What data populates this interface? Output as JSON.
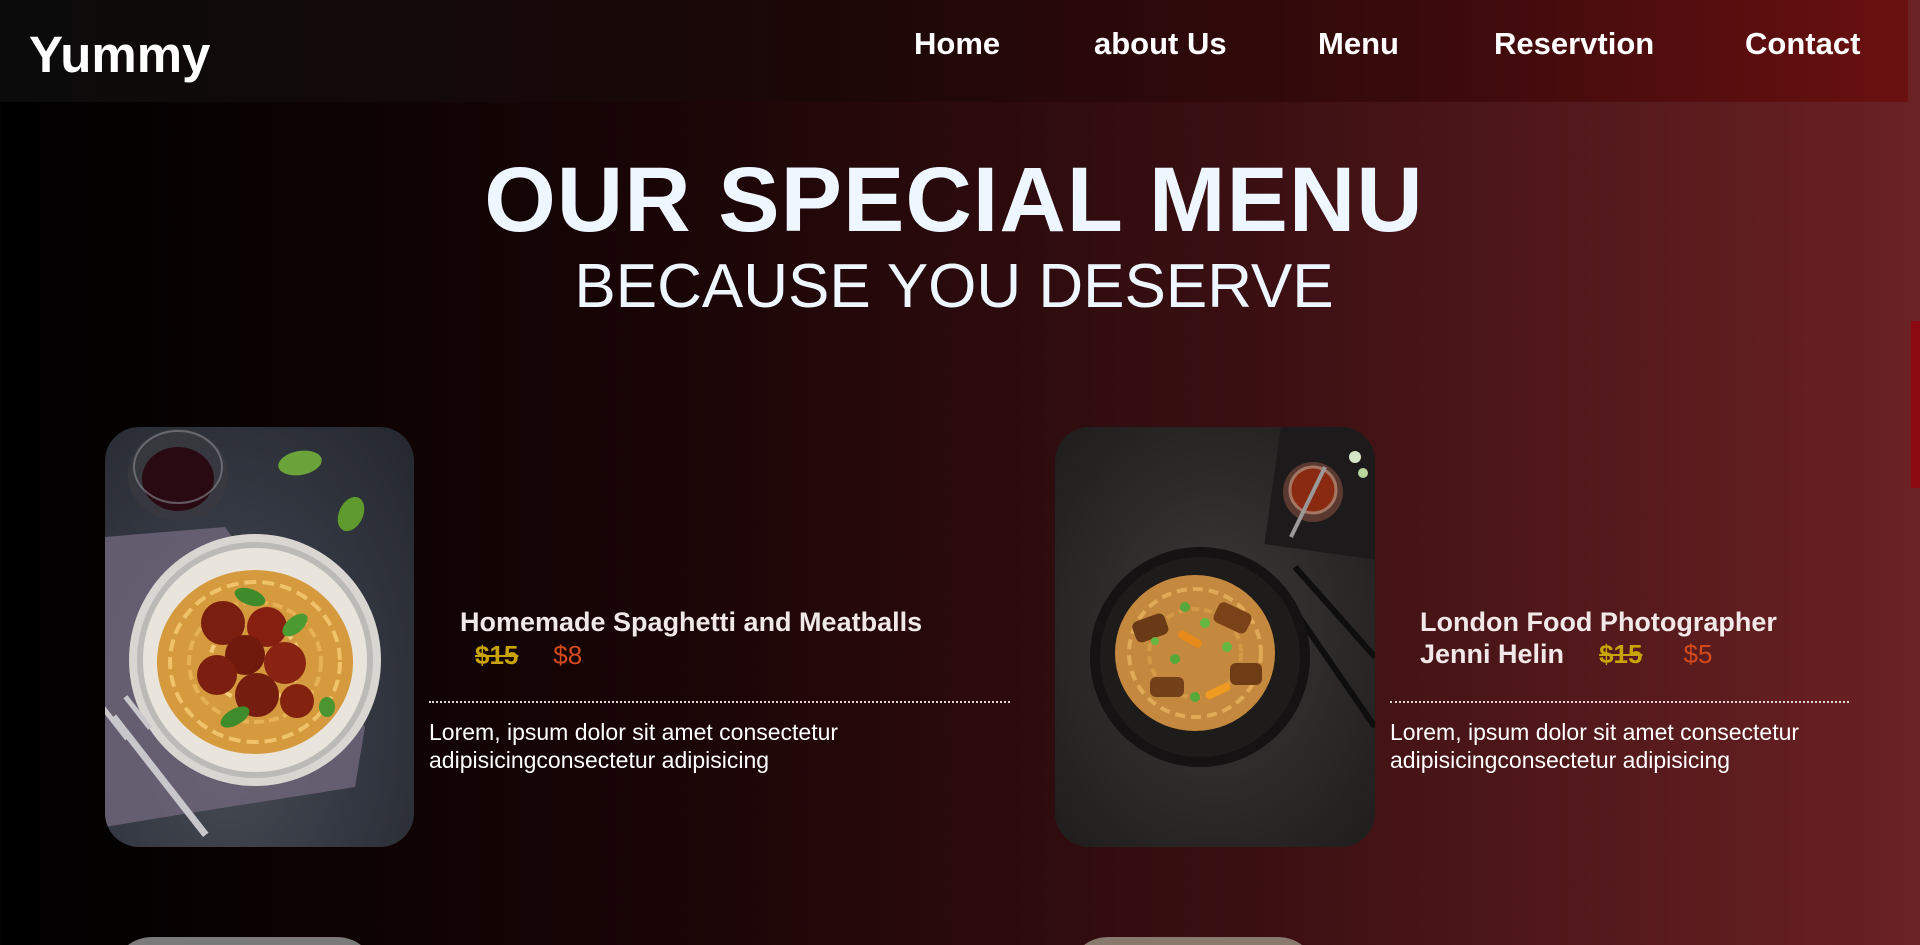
{
  "brand": "Yummy",
  "nav": {
    "home": "Home",
    "about": "about Us",
    "menu": "Menu",
    "reservation": "Reservtion",
    "contact": "Contact"
  },
  "hero": {
    "title": "OUR SPECIAL MENU",
    "subtitle": "BECAUSE YOU DESERVE"
  },
  "dishes": [
    {
      "name": "Homemade Spaghetti and Meatballs",
      "old_price": "$15",
      "new_price": "$8",
      "description_line1": "Lorem, ipsum dolor sit amet consectetur",
      "description_line2": "adipisicingconsectetur adipisicing"
    },
    {
      "name_line1": "London Food Photographer",
      "name_line2": "Jenni Helin",
      "old_price": "$15",
      "new_price": "$5",
      "description_line1": "Lorem, ipsum dolor sit amet consectetur",
      "description_line2": "adipisicingconsectetur adipisicing"
    }
  ],
  "colors": {
    "old_price": "#c9a400",
    "new_price": "#d24a1c",
    "heading": "#eef6ff",
    "scrollbar_thumb": "#8b0a12"
  }
}
